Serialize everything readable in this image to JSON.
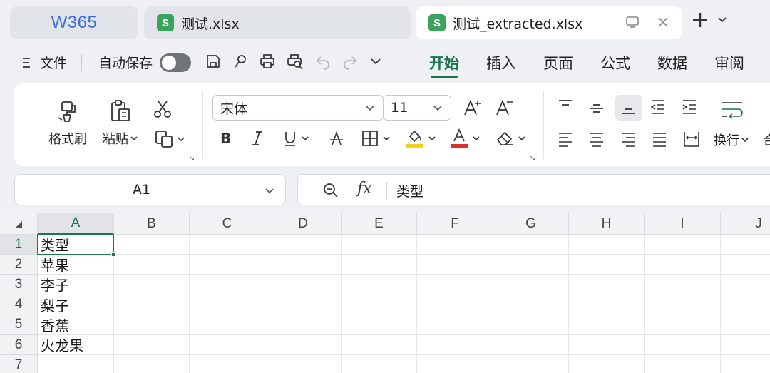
{
  "tabbar": {
    "logo": "W365",
    "tabs": [
      {
        "badge": "S",
        "name": "测试.xlsx",
        "active": false
      },
      {
        "badge": "S",
        "name": "测试_extracted.xlsx",
        "active": true
      }
    ],
    "icons": [
      "monitor-icon",
      "close-icon",
      "plus-icon",
      "chevron-down-icon"
    ]
  },
  "menu": {
    "file": "文件",
    "autosave": "自动保存",
    "autosave_on": false,
    "tabs": [
      "开始",
      "插入",
      "页面",
      "公式",
      "数据",
      "审阅"
    ],
    "active_tab": "开始"
  },
  "ribbon": {
    "format_painter": "格式刷",
    "paste": "粘贴",
    "font_name": "宋体",
    "font_size": "11",
    "wrap": "换行",
    "more": "合"
  },
  "formula_bar": {
    "cell_ref": "A1",
    "fx": "fx",
    "content": "类型"
  },
  "sheet": {
    "columns": [
      "A",
      "B",
      "C",
      "D",
      "E",
      "F",
      "G",
      "H",
      "I",
      "J"
    ],
    "rows": [
      "1",
      "2",
      "3",
      "4",
      "5",
      "6",
      "7"
    ],
    "cells": [
      "类型",
      "苹果",
      "李子",
      "梨子",
      "香蕉",
      "火龙果",
      ""
    ],
    "selected": "A1"
  },
  "colors": {
    "accent_green": "#16754a",
    "sheet_badge": "#3aa45c",
    "logo_blue": "#3b6fe0",
    "highlight_yellow": "#f2d21b",
    "font_red": "#d9302c"
  }
}
